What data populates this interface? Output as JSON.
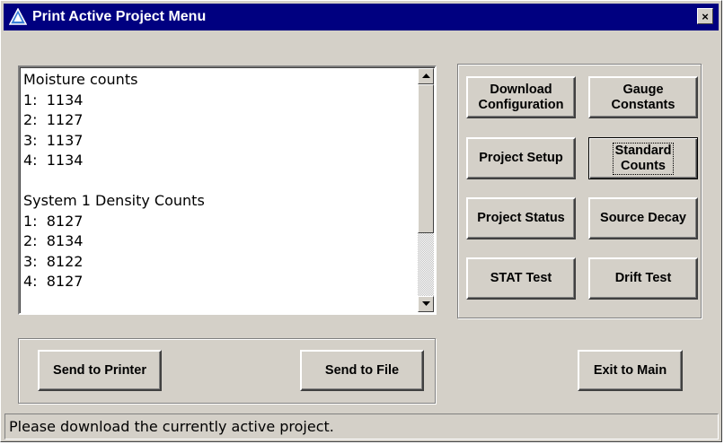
{
  "window": {
    "title": "Print Active Project Menu",
    "close_label": "×"
  },
  "list": {
    "lines": [
      "Moisture counts",
      "1:  1134",
      "2:  1127",
      "3:  1137",
      "4:  1134",
      "",
      "System 1 Density Counts",
      "1:  8127",
      "2:  8134",
      "3:  8122",
      "4:  8127"
    ]
  },
  "right_panel": {
    "download_config_label": "Download\nConfiguration",
    "gauge_constants_label": "Gauge\nConstants",
    "project_setup_label": "Project Setup",
    "standard_counts_label": "Standard\nCounts",
    "project_status_label": "Project Status",
    "source_decay_label": "Source Decay",
    "stat_test_label": "STAT Test",
    "drift_test_label": "Drift Test"
  },
  "bottom": {
    "send_printer_label": "Send to Printer",
    "send_file_label": "Send to File",
    "exit_main_label": "Exit to Main"
  },
  "status": {
    "text": "Please download the currently active project."
  },
  "icons": {
    "app": "blue-triangle-app-icon",
    "close": "close-icon",
    "scroll_up": "arrow-up-icon",
    "scroll_down": "arrow-down-icon"
  },
  "colors": {
    "titlebar": "#000080",
    "face": "#d4d0c8"
  }
}
